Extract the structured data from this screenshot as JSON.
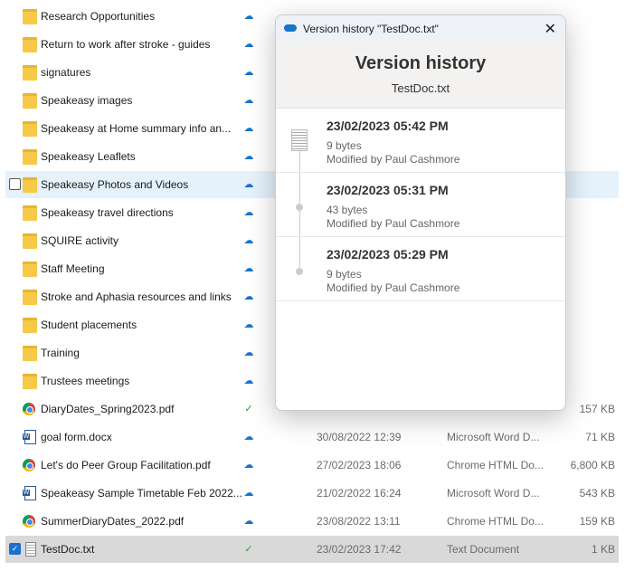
{
  "files": [
    {
      "name": "Research Opportunities",
      "kind": "folder",
      "status": "cloud"
    },
    {
      "name": "Return to work after stroke - guides",
      "kind": "folder",
      "status": "cloud"
    },
    {
      "name": "signatures",
      "kind": "folder",
      "status": "cloud"
    },
    {
      "name": "Speakeasy  images",
      "kind": "folder",
      "status": "cloud"
    },
    {
      "name": "Speakeasy at Home summary info an...",
      "kind": "folder",
      "status": "cloud"
    },
    {
      "name": "Speakeasy Leaflets",
      "kind": "folder",
      "status": "cloud"
    },
    {
      "name": "Speakeasy Photos and Videos",
      "kind": "folder",
      "status": "cloud"
    },
    {
      "name": "Speakeasy travel directions",
      "kind": "folder",
      "status": "cloud"
    },
    {
      "name": "SQUIRE activity",
      "kind": "folder",
      "status": "cloud"
    },
    {
      "name": "Staff Meeting",
      "kind": "folder",
      "status": "cloud"
    },
    {
      "name": "Stroke and Aphasia resources and links",
      "kind": "folder",
      "status": "cloud"
    },
    {
      "name": "Student placements",
      "kind": "folder",
      "status": "cloud"
    },
    {
      "name": "Training",
      "kind": "folder",
      "status": "cloud"
    },
    {
      "name": "Trustees meetings",
      "kind": "folder",
      "status": "cloud"
    },
    {
      "name": "DiaryDates_Spring2023.pdf",
      "kind": "chrome",
      "status": "ok",
      "date": "",
      "type": "",
      "size": "157 KB"
    },
    {
      "name": "goal form.docx",
      "kind": "word",
      "status": "cloud",
      "date": "30/08/2022 12:39",
      "type": "Microsoft Word D...",
      "size": "71 KB"
    },
    {
      "name": "Let's do Peer Group Facilitation.pdf",
      "kind": "chrome",
      "status": "cloud",
      "date": "27/02/2023 18:06",
      "type": "Chrome HTML Do...",
      "size": "6,800 KB"
    },
    {
      "name": "Speakeasy Sample Timetable Feb 2022...",
      "kind": "word",
      "status": "cloud",
      "date": "21/02/2022 16:24",
      "type": "Microsoft Word D...",
      "size": "543 KB"
    },
    {
      "name": "SummerDiaryDates_2022.pdf",
      "kind": "chrome",
      "status": "cloud",
      "date": "23/08/2022 13:11",
      "type": "Chrome HTML Do...",
      "size": "159 KB"
    },
    {
      "name": "TestDoc.txt",
      "kind": "txt",
      "status": "ok",
      "date": "23/02/2023 17:42",
      "type": "Text Document",
      "size": "1 KB"
    }
  ],
  "dialog": {
    "title": "Version history \"TestDoc.txt\"",
    "heading": "Version history",
    "filename": "TestDoc.txt",
    "close": "✕",
    "versions": [
      {
        "date": "23/02/2023 05:42 PM",
        "size": "9 bytes",
        "by": "Modified by Paul Cashmore"
      },
      {
        "date": "23/02/2023 05:31 PM",
        "size": "43 bytes",
        "by": "Modified by Paul Cashmore"
      },
      {
        "date": "23/02/2023 05:29 PM",
        "size": "9 bytes",
        "by": "Modified by Paul Cashmore"
      }
    ]
  }
}
